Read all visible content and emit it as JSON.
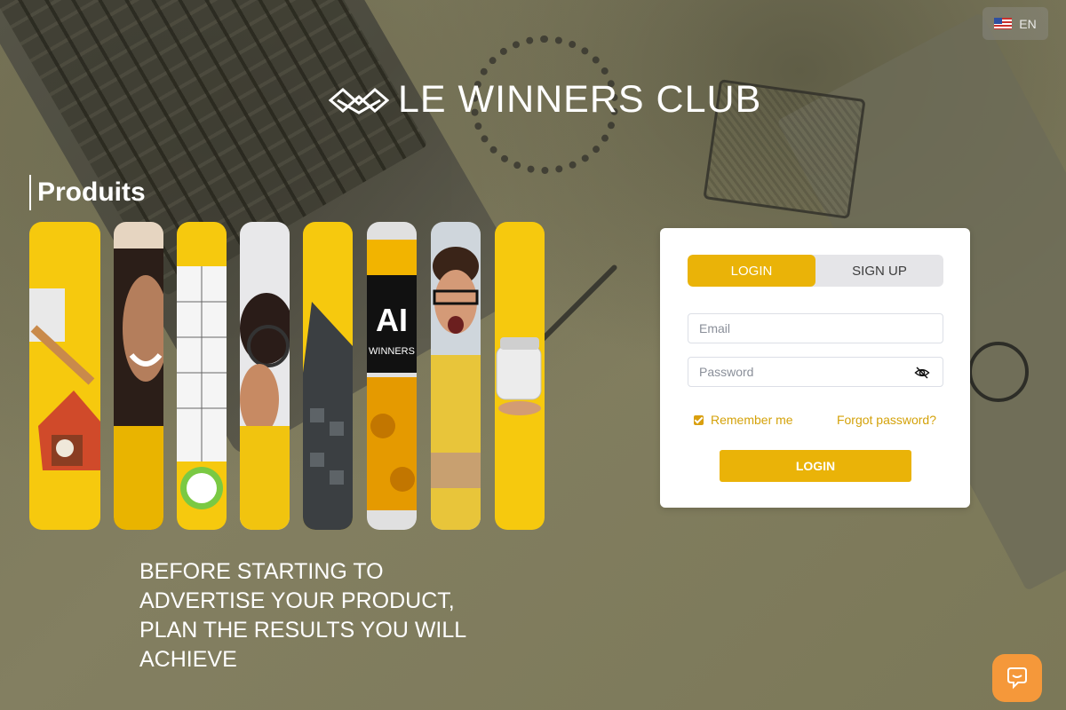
{
  "language": {
    "code": "EN",
    "flag_icon": "us-flag-icon"
  },
  "brand": {
    "name": "LE WINNERS CLUB",
    "logo_icon": "winners-club-logo-icon"
  },
  "products": {
    "heading": "Produits",
    "strips": [
      {
        "name": "dog-house-product",
        "bg": "#f6c90e"
      },
      {
        "name": "smiling-woman",
        "bg": "#e6d5c1"
      },
      {
        "name": "calendar-clock",
        "bg": "#f6c90e"
      },
      {
        "name": "magnifier-woman",
        "bg": "#e8e8ea"
      },
      {
        "name": "calculator",
        "bg": "#f6c90e"
      },
      {
        "name": "ai-robot",
        "bg": "#e0e0e0",
        "text": "AI",
        "subtext": "WINNERS"
      },
      {
        "name": "excited-man",
        "bg": "#cfd6dc"
      },
      {
        "name": "chopper-product",
        "bg": "#f6c90e"
      }
    ]
  },
  "tagline": "BEFORE STARTING TO ADVERTISE YOUR PRODUCT, PLAN THE RESULTS YOU WILL ACHIEVE",
  "auth": {
    "tabs": [
      {
        "label": "LOGIN",
        "active": true
      },
      {
        "label": "SIGN UP",
        "active": false
      }
    ],
    "email_placeholder": "Email",
    "password_placeholder": "Password",
    "remember_label": "Remember me",
    "remember_checked": true,
    "forgot_label": "Forgot password?",
    "submit_label": "LOGIN"
  },
  "colors": {
    "accent": "#eab308",
    "link": "#d4a20a",
    "chat": "#f5983a"
  },
  "chat": {
    "icon": "chat-bubble-icon"
  }
}
